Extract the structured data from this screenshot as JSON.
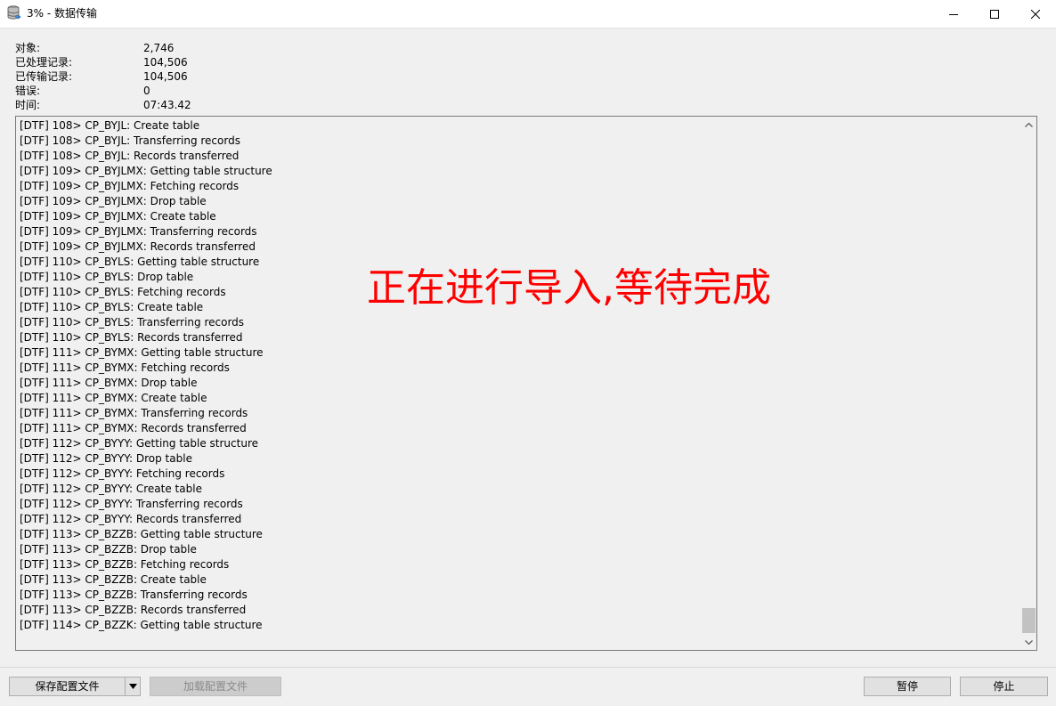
{
  "window": {
    "title": "3% - 数据传输",
    "icon": "database-transfer-icon",
    "controls": [
      "minimize-icon",
      "maximize-icon",
      "close-icon"
    ]
  },
  "stats": [
    {
      "label": "对象:",
      "value": "2,746"
    },
    {
      "label": "已处理记录:",
      "value": "104,506"
    },
    {
      "label": "已传输记录:",
      "value": "104,506"
    },
    {
      "label": "错误:",
      "value": "0"
    },
    {
      "label": "时间:",
      "value": "07:43.42"
    }
  ],
  "log": [
    "[DTF] 108> CP_BYJL: Create table",
    "[DTF] 108> CP_BYJL: Transferring records",
    "[DTF] 108> CP_BYJL: Records transferred",
    "[DTF] 109> CP_BYJLMX: Getting table structure",
    "[DTF] 109> CP_BYJLMX: Fetching records",
    "[DTF] 109> CP_BYJLMX: Drop table",
    "[DTF] 109> CP_BYJLMX: Create table",
    "[DTF] 109> CP_BYJLMX: Transferring records",
    "[DTF] 109> CP_BYJLMX: Records transferred",
    "[DTF] 110> CP_BYLS: Getting table structure",
    "[DTF] 110> CP_BYLS: Drop table",
    "[DTF] 110> CP_BYLS: Fetching records",
    "[DTF] 110> CP_BYLS: Create table",
    "[DTF] 110> CP_BYLS: Transferring records",
    "[DTF] 110> CP_BYLS: Records transferred",
    "[DTF] 111> CP_BYMX: Getting table structure",
    "[DTF] 111> CP_BYMX: Fetching records",
    "[DTF] 111> CP_BYMX: Drop table",
    "[DTF] 111> CP_BYMX: Create table",
    "[DTF] 111> CP_BYMX: Transferring records",
    "[DTF] 111> CP_BYMX: Records transferred",
    "[DTF] 112> CP_BYYY: Getting table structure",
    "[DTF] 112> CP_BYYY: Drop table",
    "[DTF] 112> CP_BYYY: Fetching records",
    "[DTF] 112> CP_BYYY: Create table",
    "[DTF] 112> CP_BYYY: Transferring records",
    "[DTF] 112> CP_BYYY: Records transferred",
    "[DTF] 113> CP_BZZB: Getting table structure",
    "[DTF] 113> CP_BZZB: Drop table",
    "[DTF] 113> CP_BZZB: Fetching records",
    "[DTF] 113> CP_BZZB: Create table",
    "[DTF] 113> CP_BZZB: Transferring records",
    "[DTF] 113> CP_BZZB: Records transferred",
    "[DTF] 114> CP_BZZK: Getting table structure"
  ],
  "overlay_annotation": "正在进行导入,等待完成",
  "buttons": {
    "save_config": "保存配置文件",
    "load_config": "加载配置文件",
    "pause": "暂停",
    "stop": "停止"
  },
  "colors": {
    "overlay": "#ff0000",
    "window_bg": "#f0f0f0"
  }
}
